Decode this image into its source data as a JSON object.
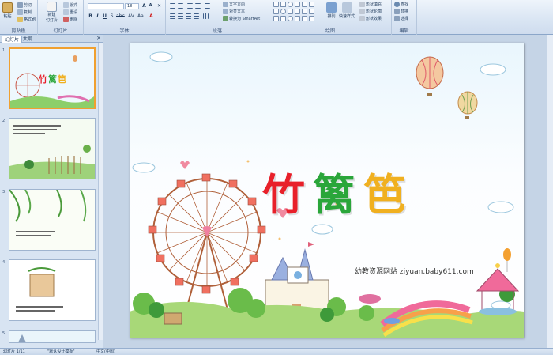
{
  "ribbon": {
    "clipboard": {
      "label": "剪贴板",
      "paste": "粘贴",
      "cut": "剪切",
      "copy": "复制",
      "format_painter": "格式刷"
    },
    "slides": {
      "label": "幻灯片",
      "new_slide": "新建",
      "new_slide2": "幻灯片",
      "layout": "版式",
      "reset": "重设",
      "delete": "删除"
    },
    "font": {
      "label": "字体",
      "font_name": "",
      "font_size": "18"
    },
    "paragraph": {
      "label": "段落",
      "text_direction": "文字方向",
      "align_text": "对齐文本",
      "convert_smartart": "转换为 SmartArt"
    },
    "drawing": {
      "label": "绘图",
      "arrange": "排列",
      "quick_styles": "快速样式",
      "shape_fill": "形状填充",
      "shape_outline": "形状轮廓",
      "shape_effects": "形状效果"
    },
    "editing": {
      "label": "编辑",
      "find": "查找",
      "replace": "替换",
      "select": "选择"
    }
  },
  "panel": {
    "tab_slides": "幻灯片",
    "tab_outline": "大纲",
    "slide_numbers": [
      "1",
      "2",
      "3",
      "4",
      "5"
    ]
  },
  "slide": {
    "title_chars": [
      "竹",
      "篱",
      "笆"
    ],
    "site": "幼教资源网站  ziyuan.baby611.com"
  },
  "thumb1": {
    "title": "竹篱笆"
  },
  "status": {
    "slide_info": "幻灯片 1/11",
    "theme": "\"默认设计模板\"",
    "language": "中文(中国)"
  },
  "colors": {
    "title1": "#e8202a",
    "title2": "#2aa63a",
    "title3": "#f0b020",
    "selection": "#f0a030"
  }
}
